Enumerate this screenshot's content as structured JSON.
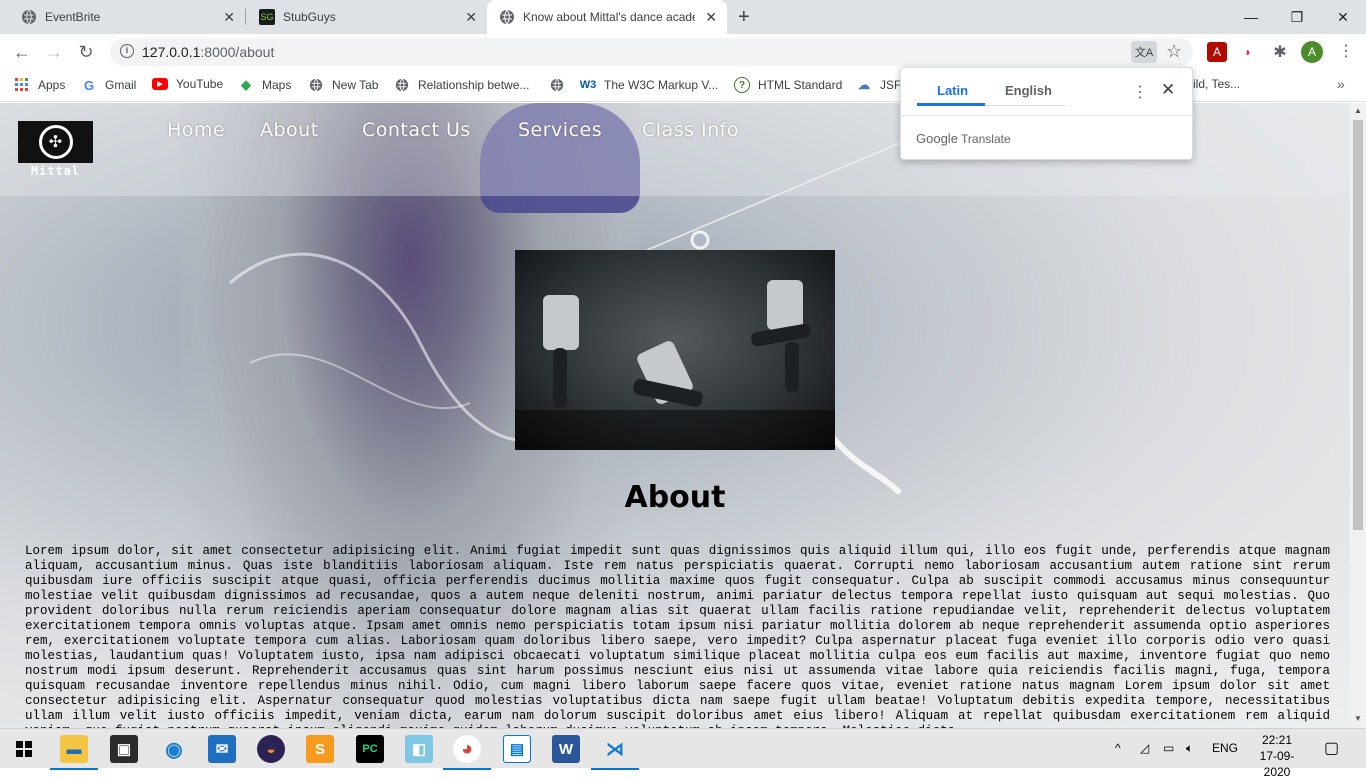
{
  "browser": {
    "tabs": [
      {
        "title": "EventBrite",
        "icon": "globe-icon",
        "active": false
      },
      {
        "title": "StubGuys",
        "icon": "sg-icon",
        "active": false
      },
      {
        "title": "Know about Mittal's dance academy",
        "icon": "globe-icon",
        "active": true
      }
    ],
    "url_host": "127.0.0.1",
    "url_path": ":8000/about",
    "bookmarks": [
      {
        "label": "Apps",
        "icon": "apps-grid-icon"
      },
      {
        "label": "Gmail",
        "icon": "google-icon"
      },
      {
        "label": "YouTube",
        "icon": "youtube-icon"
      },
      {
        "label": "Maps",
        "icon": "maps-icon"
      },
      {
        "label": "New Tab",
        "icon": "globe-icon"
      },
      {
        "label": "Relationship betwe...",
        "icon": "globe-icon"
      },
      {
        "label": "",
        "icon": "globe-icon"
      },
      {
        "label": "The W3C Markup V...",
        "icon": "w3c-icon"
      },
      {
        "label": "HTML Standard",
        "icon": "html-standard-icon"
      },
      {
        "label": "JSFi",
        "icon": "jsfiddle-icon"
      },
      {
        "label": "ild, Tes...",
        "icon": ""
      }
    ],
    "avatar_letter": "A"
  },
  "translate_popup": {
    "tab_source": "Latin",
    "tab_target": "English",
    "brand_google": "Google",
    "brand_translate": "Translate"
  },
  "site": {
    "logo_text": "Mittal",
    "nav": [
      "Home",
      "About",
      "Contact Us",
      "Services",
      "Class Info"
    ],
    "heading": "About",
    "body": "Lorem ipsum dolor, sit amet consectetur adipisicing elit. Animi fugiat impedit sunt quas dignissimos quis aliquid illum qui, illo eos fugit unde, perferendis atque magnam aliquam, accusantium minus. Quas iste blanditiis laboriosam aliquam. Iste rem natus perspiciatis quaerat. Corrupti nemo laboriosam accusantium autem ratione sint rerum quibusdam iure officiis suscipit atque quasi, officia perferendis ducimus mollitia maxime quos fugit consequatur. Culpa ab suscipit commodi accusamus minus consequuntur molestiae velit quibusdam dignissimos ad recusandae, quos a autem neque deleniti nostrum, animi pariatur delectus tempora repellat iusto quisquam aut sequi molestias. Quo provident doloribus nulla rerum reiciendis aperiam consequatur dolore magnam alias sit quaerat ullam facilis ratione repudiandae velit, reprehenderit delectus voluptatem exercitationem tempora omnis voluptas atque. Ipsam amet omnis nemo perspiciatis totam ipsum nisi pariatur mollitia dolorem ab neque reprehenderit assumenda optio asperiores rem, exercitationem voluptate tempora cum alias. Laboriosam quam doloribus libero saepe, vero impedit? Culpa aspernatur placeat fuga eveniet illo corporis odio vero quasi molestias, laudantium quas! Voluptatem iusto, ipsa nam adipisci obcaecati voluptatum similique placeat mollitia culpa eos eum facilis aut maxime, inventore fugiat quo nemo nostrum modi ipsum deserunt. Reprehenderit accusamus quas sint harum possimus nesciunt eius nisi ut assumenda vitae labore quia reiciendis facilis magni, fuga, tempora quisquam recusandae inventore repellendus minus nihil. Odio, cum magni libero laborum saepe facere quos vitae, eveniet ratione natus magnam Lorem ipsum dolor sit amet consectetur adipisicing elit. Aspernatur consequatur quod molestias voluptatibus dicta nam saepe fugit ullam beatae! Voluptatum debitis expedita tempore, necessitatibus ullam illum velit iusto officiis impedit, veniam dicta, earum nam dolorum suscipit doloribus amet eius libero! Aliquam at repellat quibusdam exercitationem rem aliquid veniam, quo fugiat nostrum quaerat ipsum eligendi maxime quidem laborum ducimus voluptatum ab ipsam tempora. Molestiae dicta"
  },
  "taskbar": {
    "language": "ENG",
    "time": "22:21",
    "date": "17-09-2020"
  }
}
